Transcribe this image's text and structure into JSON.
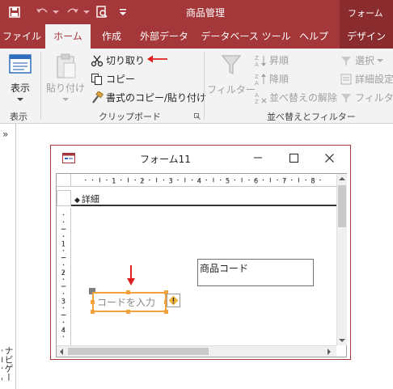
{
  "app": {
    "title": "商品管理",
    "context_tab": "フォーム"
  },
  "tabs": [
    {
      "label": "ファイル"
    },
    {
      "label": "ホーム"
    },
    {
      "label": "作成"
    },
    {
      "label": "外部データ"
    },
    {
      "label": "データベース ツール"
    },
    {
      "label": "ヘルプ"
    },
    {
      "label": "デザイン"
    }
  ],
  "ribbon": {
    "view_group": {
      "button": "表示",
      "label": "表示"
    },
    "clipboard_group": {
      "paste": "貼り付け",
      "cut": "切り取り",
      "copy": "コピー",
      "format_painter": "書式のコピー/貼り付け",
      "label": "クリップボード"
    },
    "sort_filter_group": {
      "filter": "フィルター",
      "ascending": "昇順",
      "descending": "降順",
      "clear_sort": "並べ替えの解除",
      "selection": "選択",
      "advanced": "詳細設定",
      "toggle_filter": "フィルターの",
      "label": "並べ替えとフィルター"
    }
  },
  "nav_pane": {
    "label": "ナビゲーション ウィンドウ"
  },
  "form_window": {
    "title": "フォーム11",
    "section_header": "詳細",
    "label_control": "商品コード",
    "textbox_placeholder": "コードを入力",
    "hruler_numbers": [
      "1",
      "2",
      "3",
      "4",
      "5",
      "6",
      "7",
      "8"
    ],
    "vruler_numbers": [
      "1",
      "2",
      "3",
      "4"
    ]
  },
  "colors": {
    "accent": "#a4373a",
    "selection": "#f2a23a",
    "annotation": "#e02020"
  }
}
